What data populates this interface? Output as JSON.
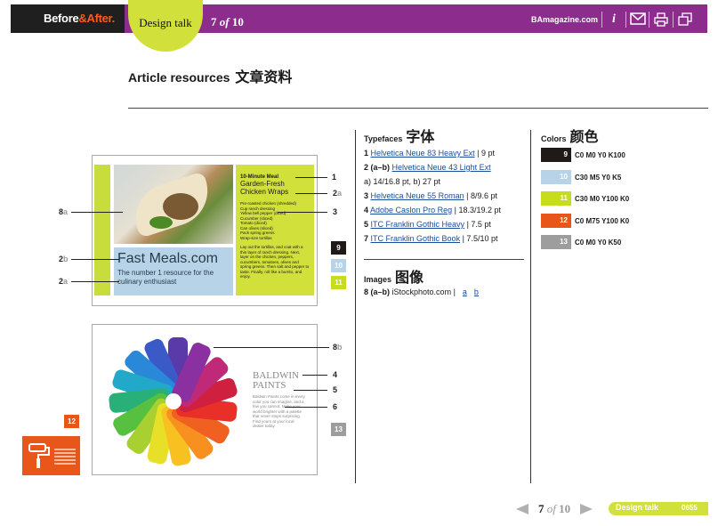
{
  "header": {
    "brand_before": "Before",
    "brand_amp": "&",
    "brand_after": "After.",
    "section": "Design talk",
    "page_current": "7",
    "page_of": "of",
    "page_total": "10",
    "site": "BAmagazine.com",
    "icons": [
      "info-icon",
      "mail-icon",
      "print-icon",
      "window-icon"
    ]
  },
  "article": {
    "title": "Article resources",
    "title_cn": "文章资料"
  },
  "thumb1": {
    "meal_label": "10-Minute Meal",
    "recipe_title": "Garden-Fresh Chicken Wraps",
    "ingredients": [
      "Pre-roasted chicken (shredded)",
      "Cup ranch dressing",
      "Yellow bell pepper (diced)",
      "Cucumber (sliced)",
      "Tomato (diced)",
      "Can olives (sliced)",
      "Pack spring greens",
      "Wrap-size tortillas"
    ],
    "instructions": "Lay out the tortillas, and coat with a thin layer of ranch dressing. Next, layer on the chicken, peppers, cucumbers, tomatoes, olives and spring greens. Then salt and pepper to taste. Finally, roll like a burrito, and enjoy.",
    "brand": "Fast Meals.com",
    "tagline": "The number 1 resource for the culinary enthusiast"
  },
  "thumb2": {
    "brand": "BALDWIN PAINTS",
    "body": "Baldwin Paints come in every color you can imagine, and a few you cannot. Make your world brighter with a palette that never stops surprising. Find yours at your local dealer today."
  },
  "callouts": {
    "c1": "1",
    "c2": "2",
    "c2a_suffix": "a",
    "c3": "3",
    "c4": "4",
    "c5": "5",
    "c6": "6",
    "c8a": "8",
    "c8a_suffix": "a",
    "c2b": "2",
    "c2b_suffix": "b",
    "c2a_left": "2",
    "c2a_left_suffix": "a",
    "c8b": "8",
    "c8b_suffix": "b"
  },
  "swatches": {
    "s9": "9",
    "s10": "10",
    "s11": "11",
    "s12": "12",
    "s13": "13"
  },
  "typefaces": {
    "heading": "Typefaces",
    "heading_cn": "字体",
    "items": [
      {
        "n": "1",
        "link": "Helvetica Neue 83 Heavy Ext",
        "spec": "| 9 pt"
      },
      {
        "n": "2 (a–b)",
        "link": "Helvetica Neue 43 Light Ext",
        "spec": ""
      },
      {
        "n": "3",
        "link": "Helvetica Neue 55 Roman",
        "spec": "| 8/9.6 pt"
      },
      {
        "n": "4",
        "link": "Adobe Caslon Pro Reg",
        "spec": "| 18.3/19.2 pt"
      },
      {
        "n": "5",
        "link": "ITC Franklin Gothic Heavy",
        "spec": "| 7.5 pt"
      },
      {
        "n": "7",
        "link": "ITC Franklin Gothic Book",
        "spec": "| 7.5/10 pt"
      }
    ],
    "sub_line": "a) 14/16.8 pt, b) 27 pt"
  },
  "images": {
    "heading": "Images",
    "heading_cn": "图像",
    "n": "8 (a–b)",
    "source": "iStockphoto.com |",
    "link_a": "a",
    "link_b": "b"
  },
  "colors": {
    "heading": "Colors",
    "heading_cn": "颜色",
    "items": [
      {
        "n": "9",
        "cmyk": "C0 M0 Y0 K100",
        "hex": "#1f1a17"
      },
      {
        "n": "10",
        "cmyk": "C30 M5 Y0 K5",
        "hex": "#b7d3e8"
      },
      {
        "n": "11",
        "cmyk": "C30 M0 Y100 K0",
        "hex": "#c8dc1e"
      },
      {
        "n": "12",
        "cmyk": "C0 M75 Y100 K0",
        "hex": "#e8561a"
      },
      {
        "n": "13",
        "cmyk": "C0 M0 Y0 K50",
        "hex": "#9d9d9d"
      }
    ]
  },
  "footer": {
    "page_current": "7",
    "page_of": "of",
    "page_total": "10",
    "section": "Design talk",
    "code": "0655"
  }
}
